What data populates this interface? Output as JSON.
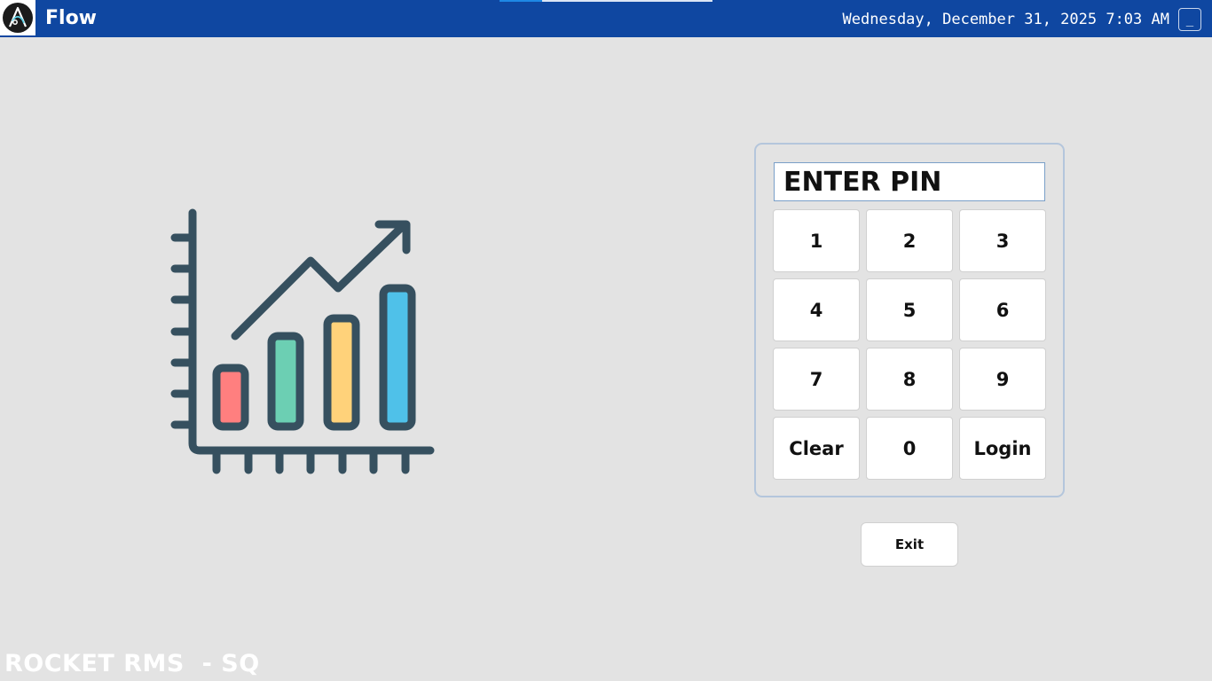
{
  "header": {
    "app_title": "Flow",
    "datetime": "Wednesday, December 31, 2025 7:03 AM",
    "minimize_label": "_",
    "logo_icon": "flow-logo-icon",
    "bar_color": "#0f47a1"
  },
  "login": {
    "pin_placeholder": "ENTER PIN",
    "keys": [
      "1",
      "2",
      "3",
      "4",
      "5",
      "6",
      "7",
      "8",
      "9",
      "Clear",
      "0",
      "Login"
    ],
    "exit_label": "Exit"
  },
  "illustration": {
    "icon": "growth-chart-icon",
    "bar_colors": [
      "#ff7f7f",
      "#6ccfb3",
      "#ffd27a",
      "#4fc1e9"
    ],
    "outline_color": "#36505f"
  },
  "footer": {
    "text": "ROCKET RMS  - SQ"
  }
}
